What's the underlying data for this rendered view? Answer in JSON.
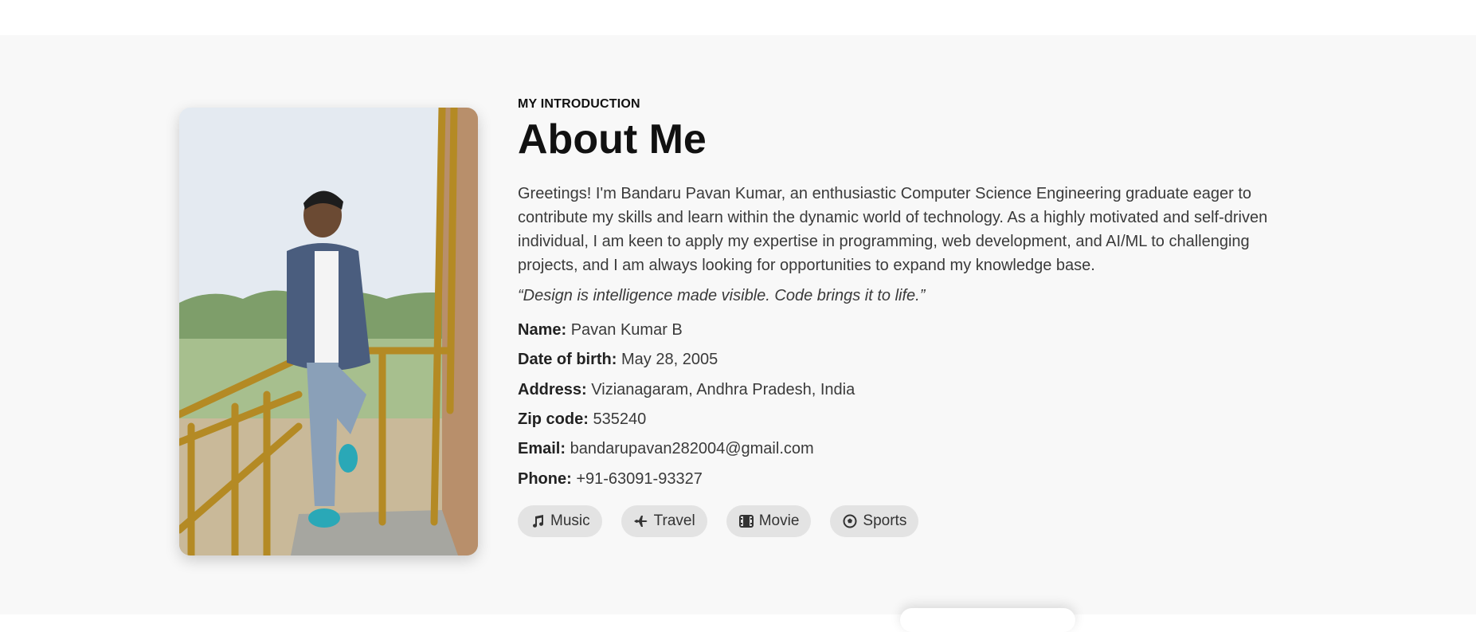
{
  "about": {
    "eyebrow": "MY INTRODUCTION",
    "title": "About Me",
    "bio": "Greetings! I'm Bandaru Pavan Kumar, an enthusiastic Computer Science Engineering graduate eager to contribute my skills and learn within the dynamic world of technology. As a highly motivated and self-driven individual, I am keen to apply my expertise in programming, web development, and AI/ML to challenging projects, and I am always looking for opportunities to expand my knowledge base.",
    "quote": "“Design is intelligence made visible. Code brings it to life.”",
    "info": [
      {
        "label": "Name:",
        "value": "Pavan Kumar B"
      },
      {
        "label": "Date of birth:",
        "value": "May 28, 2005"
      },
      {
        "label": "Address:",
        "value": "Vizianagaram, Andhra Pradesh, India"
      },
      {
        "label": "Zip code:",
        "value": "535240"
      },
      {
        "label": "Email:",
        "value": "bandarupavan282004@gmail.com"
      },
      {
        "label": "Phone:",
        "value": "+91-63091-93327"
      }
    ],
    "interests": [
      {
        "label": "Music",
        "icon": "music-icon"
      },
      {
        "label": "Travel",
        "icon": "plane-icon"
      },
      {
        "label": "Movie",
        "icon": "film-icon"
      },
      {
        "label": "Sports",
        "icon": "soccer-ball-icon"
      }
    ]
  },
  "colors": {
    "section_bg": "#f8f8f8",
    "heading": "#111111",
    "text": "#3a3a3a",
    "tag_bg": "#e3e3e3"
  }
}
